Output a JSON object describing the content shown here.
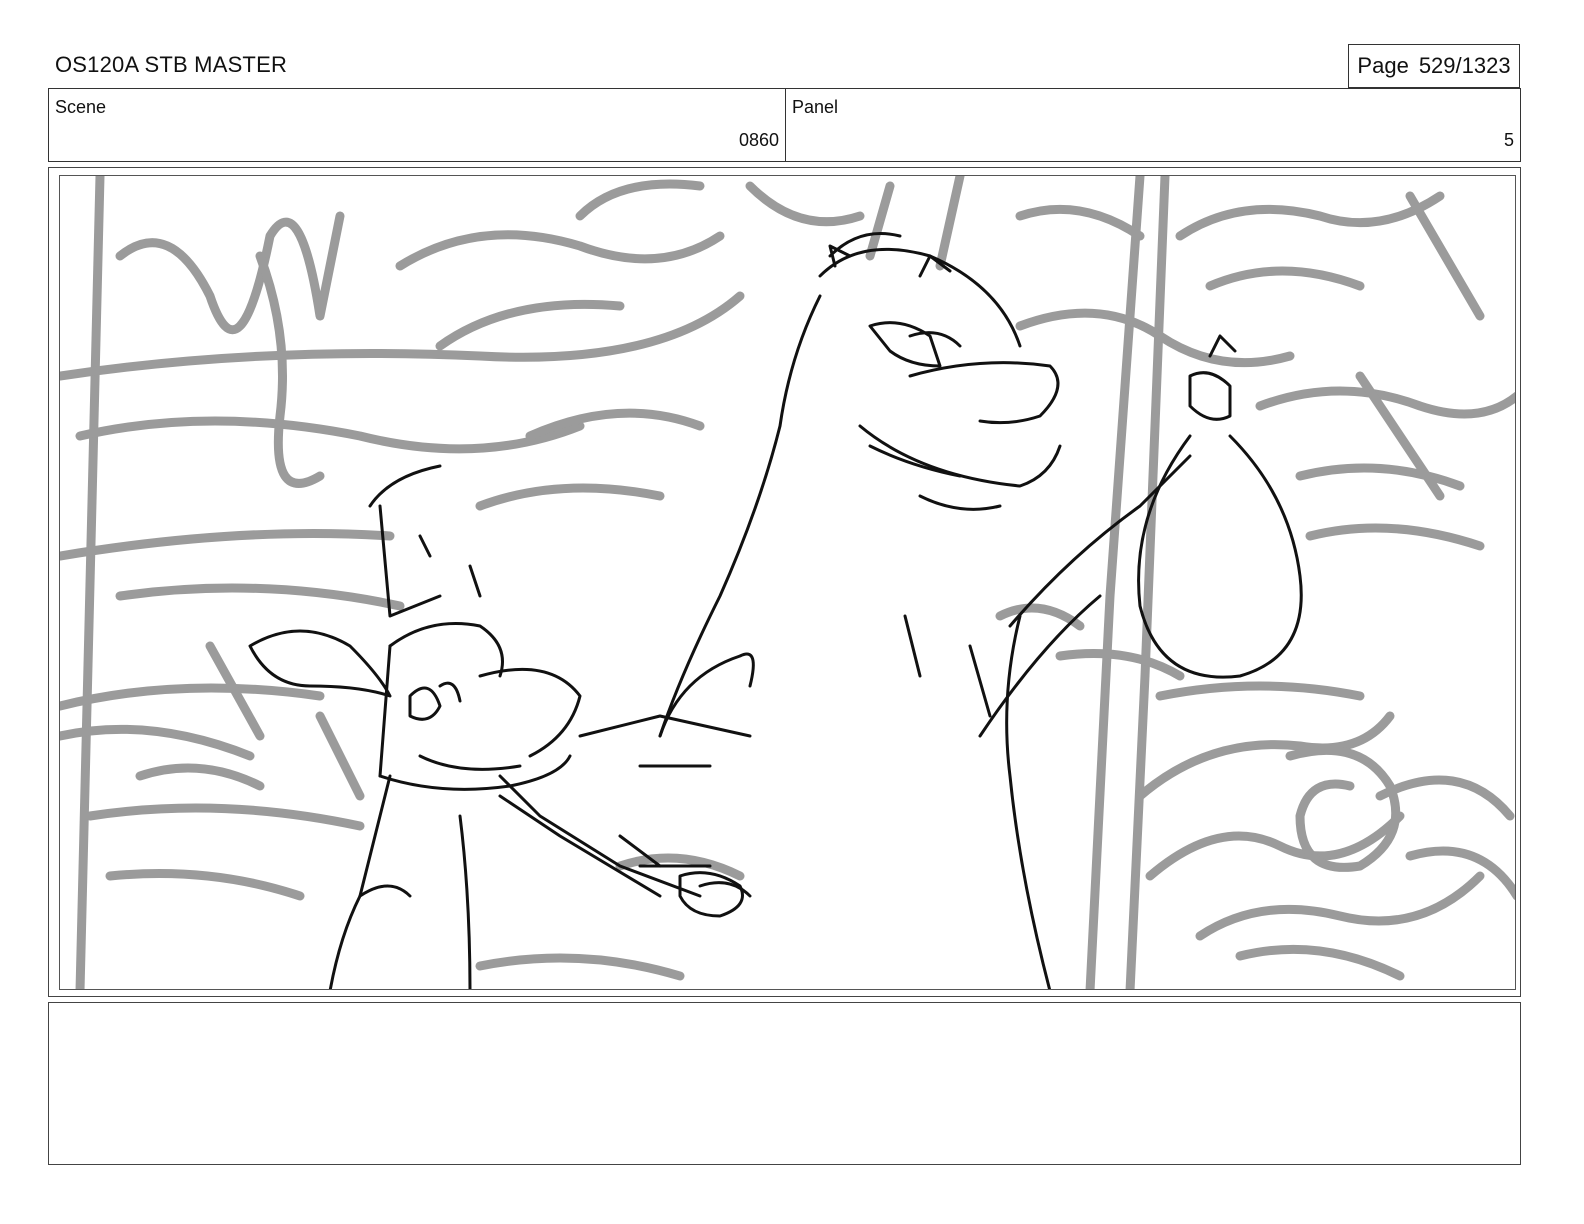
{
  "header": {
    "title": "OS120A STB MASTER",
    "page_label": "Page",
    "page_value": "529/1323"
  },
  "info": {
    "scene_label": "Scene",
    "scene_value": "0860",
    "panel_label": "Panel",
    "panel_value": "5"
  },
  "drawing": {
    "description_icon": "storyboard-sketch",
    "background_color": "#8a8a8a",
    "lineart_color": "#111111"
  },
  "notes": {
    "text": ""
  }
}
